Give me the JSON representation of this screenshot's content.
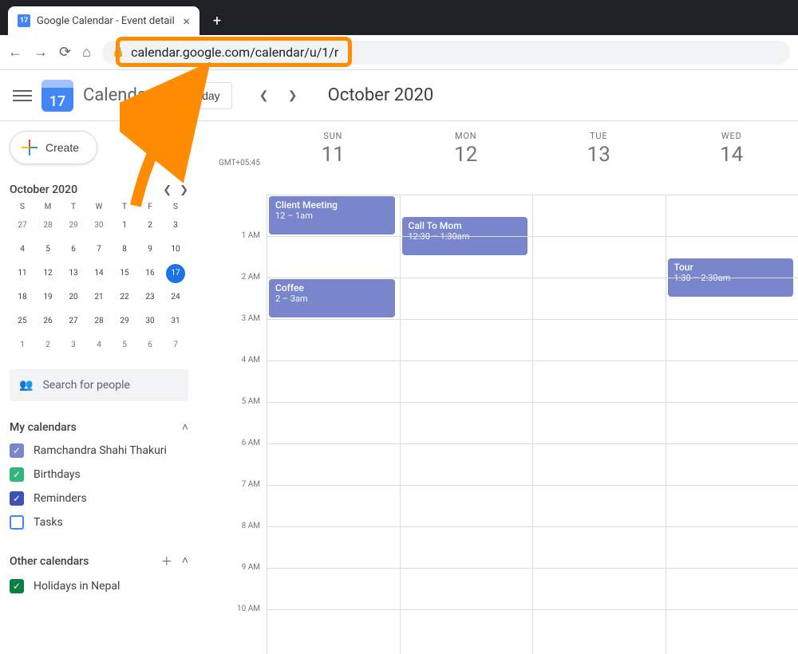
{
  "browser": {
    "tab_title": "Google Calendar - Event detail",
    "favicon_text": "17",
    "url": "calendar.google.com/calendar/u/1/r"
  },
  "header": {
    "logo_text": "17",
    "product": "Calendar",
    "today": "Today",
    "period": "October 2020"
  },
  "create_label": "Create",
  "timezone": "GMT+05:45",
  "mini_calendar": {
    "title": "October 2020",
    "dow": [
      "S",
      "M",
      "T",
      "W",
      "T",
      "F",
      "S"
    ],
    "weeks": [
      [
        {
          "n": 27
        },
        {
          "n": 28
        },
        {
          "n": 29
        },
        {
          "n": 30
        },
        {
          "n": 1,
          "c": true
        },
        {
          "n": 2,
          "c": true
        },
        {
          "n": 3,
          "c": true
        }
      ],
      [
        {
          "n": 4,
          "c": true
        },
        {
          "n": 5,
          "c": true
        },
        {
          "n": 6,
          "c": true
        },
        {
          "n": 7,
          "c": true
        },
        {
          "n": 8,
          "c": true
        },
        {
          "n": 9,
          "c": true
        },
        {
          "n": 10,
          "c": true
        }
      ],
      [
        {
          "n": 11,
          "c": true
        },
        {
          "n": 12,
          "c": true
        },
        {
          "n": 13,
          "c": true
        },
        {
          "n": 14,
          "c": true
        },
        {
          "n": 15,
          "c": true
        },
        {
          "n": 16,
          "c": true
        },
        {
          "n": 17,
          "c": true,
          "today": true
        }
      ],
      [
        {
          "n": 18,
          "c": true
        },
        {
          "n": 19,
          "c": true
        },
        {
          "n": 20,
          "c": true
        },
        {
          "n": 21,
          "c": true
        },
        {
          "n": 22,
          "c": true
        },
        {
          "n": 23,
          "c": true
        },
        {
          "n": 24,
          "c": true
        }
      ],
      [
        {
          "n": 25,
          "c": true
        },
        {
          "n": 26,
          "c": true
        },
        {
          "n": 27,
          "c": true
        },
        {
          "n": 28,
          "c": true
        },
        {
          "n": 29,
          "c": true
        },
        {
          "n": 30,
          "c": true
        },
        {
          "n": 31,
          "c": true
        }
      ],
      [
        {
          "n": 1
        },
        {
          "n": 2
        },
        {
          "n": 3
        },
        {
          "n": 4
        },
        {
          "n": 5
        },
        {
          "n": 6
        },
        {
          "n": 7
        }
      ]
    ]
  },
  "search_placeholder": "Search for people",
  "sections": {
    "my": "My calendars",
    "other": "Other calendars"
  },
  "my_calendars": [
    {
      "label": "Ramchandra Shahi Thakuri",
      "color": "#7986cb",
      "checked": true
    },
    {
      "label": "Birthdays",
      "color": "#33b679",
      "checked": true
    },
    {
      "label": "Reminders",
      "color": "#3f51b5",
      "checked": true
    },
    {
      "label": "Tasks",
      "color": "#4285f4",
      "checked": false
    }
  ],
  "other_calendars": [
    {
      "label": "Holidays in Nepal",
      "color": "#0b8043",
      "checked": true
    }
  ],
  "days": [
    {
      "dow": "SUN",
      "num": "11"
    },
    {
      "dow": "MON",
      "num": "12"
    },
    {
      "dow": "TUE",
      "num": "13"
    },
    {
      "dow": "WED",
      "num": "14"
    }
  ],
  "hours": [
    "",
    "1 AM",
    "2 AM",
    "3 AM",
    "4 AM",
    "5 AM",
    "6 AM",
    "7 AM",
    "8 AM",
    "9 AM",
    "10 AM"
  ],
  "events": [
    {
      "col": 0,
      "start": 0,
      "span": 1,
      "title": "Client Meeting",
      "time": "12 – 1am"
    },
    {
      "col": 1,
      "start": 0.5,
      "span": 1,
      "title": "Call To Mom",
      "time": "12:30 – 1:30am"
    },
    {
      "col": 0,
      "start": 2,
      "span": 1,
      "title": "Coffee",
      "time": "2 – 3am"
    },
    {
      "col": 3,
      "start": 1.5,
      "span": 1,
      "title": "Tour",
      "time": "1:30 – 2:30am"
    }
  ]
}
